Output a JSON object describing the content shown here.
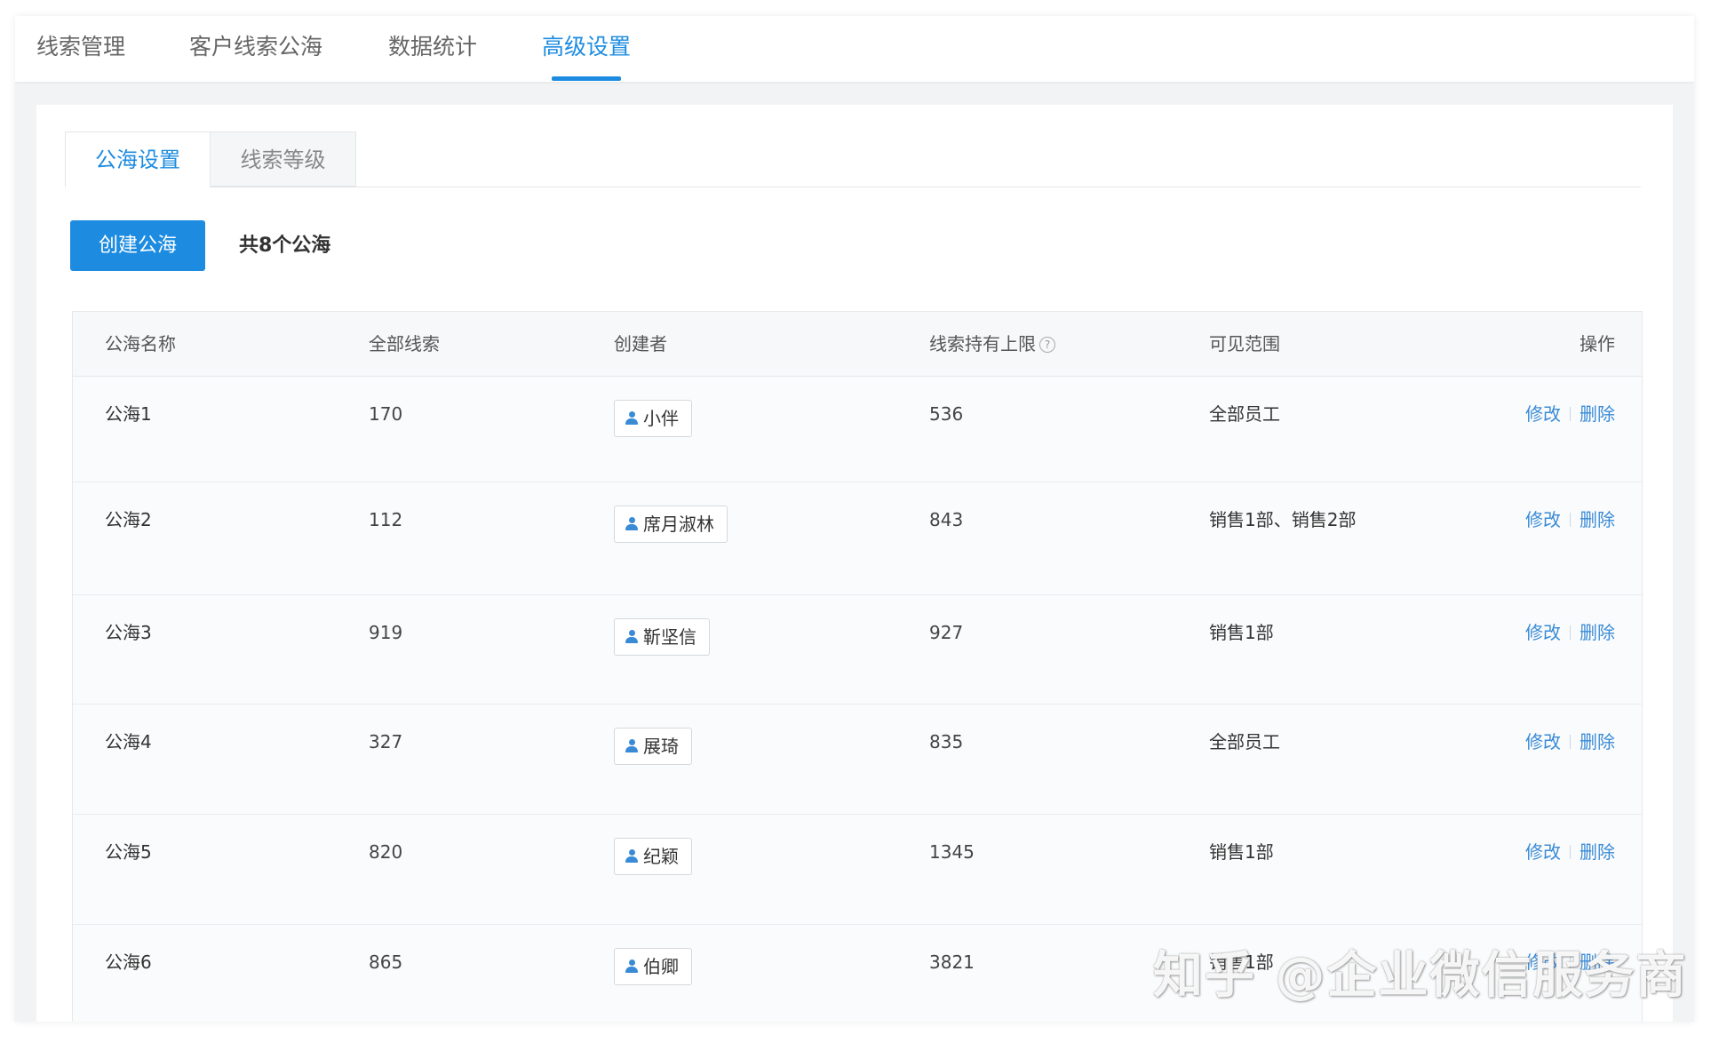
{
  "top_tabs": [
    {
      "label": "线索管理",
      "active": false
    },
    {
      "label": "客户线索公海",
      "active": false
    },
    {
      "label": "数据统计",
      "active": false
    },
    {
      "label": "高级设置",
      "active": true
    }
  ],
  "sub_tabs": [
    {
      "label": "公海设置",
      "active": true
    },
    {
      "label": "线索等级",
      "active": false
    }
  ],
  "toolbar": {
    "create_label": "创建公海",
    "count_text": "共8个公海"
  },
  "table": {
    "headers": {
      "name": "公海名称",
      "total": "全部线索",
      "creator": "创建者",
      "limit": "线索持有上限",
      "limit_help_icon": "question-circle-icon",
      "scope": "可见范围",
      "actions": "操作"
    },
    "rows": [
      {
        "name": "公海1",
        "total": "170",
        "creator": "小伴",
        "limit": "536",
        "scope": "全部员工",
        "edit": "修改",
        "delete": "删除"
      },
      {
        "name": "公海2",
        "total": "112",
        "creator": "席月淑林",
        "limit": "843",
        "scope": "销售1部、销售2部",
        "edit": "修改",
        "delete": "删除"
      },
      {
        "name": "公海3",
        "total": "919",
        "creator": "靳坚信",
        "limit": "927",
        "scope": "销售1部",
        "edit": "修改",
        "delete": "删除"
      },
      {
        "name": "公海4",
        "total": "327",
        "creator": "展琦",
        "limit": "835",
        "scope": "全部员工",
        "edit": "修改",
        "delete": "删除"
      },
      {
        "name": "公海5",
        "total": "820",
        "creator": "纪颖",
        "limit": "1345",
        "scope": "销售1部",
        "edit": "修改",
        "delete": "删除"
      },
      {
        "name": "公海6",
        "total": "865",
        "creator": "伯卿",
        "limit": "3821",
        "scope": "销售1部",
        "edit": "修改",
        "delete": "删除"
      }
    ]
  },
  "watermark": "知乎 @企业微信服务商",
  "colors": {
    "accent": "#1d8ce0",
    "link": "#3a8bd6"
  }
}
